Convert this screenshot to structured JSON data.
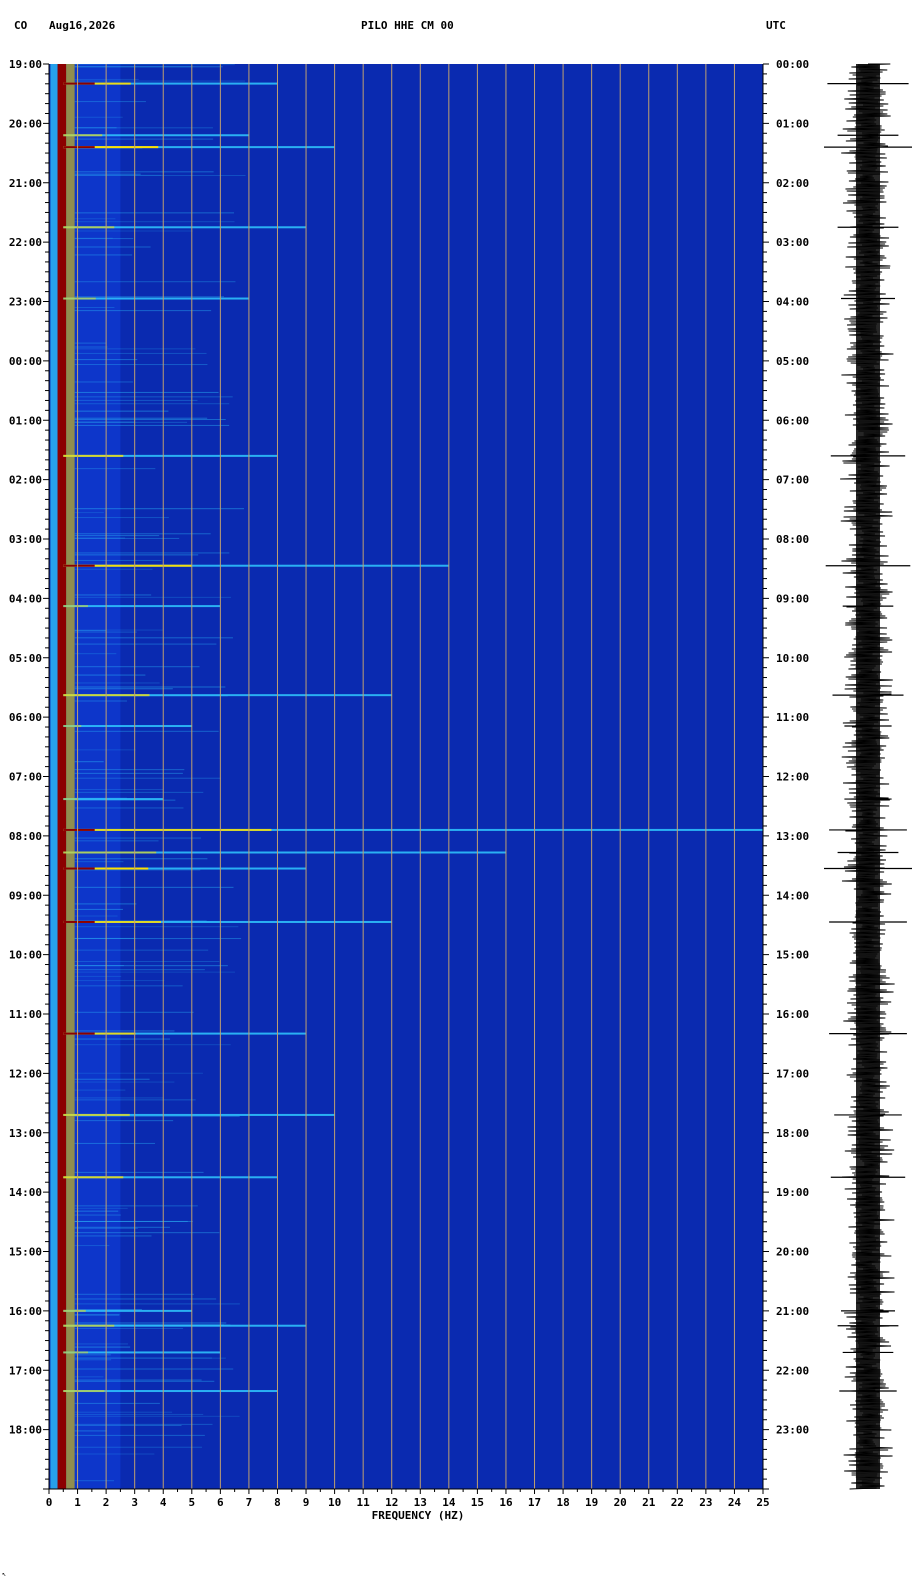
{
  "header": {
    "network": "CO",
    "date": "Aug16,2026",
    "channel": "PILO HHE CM 00",
    "timezone": "UTC"
  },
  "chart_data": {
    "type": "heatmap",
    "title": "PILO HHE CM 00",
    "xlabel": "FREQUENCY (HZ)",
    "xlim": [
      0,
      25
    ],
    "x_ticks": [
      "0",
      "1",
      "2",
      "3",
      "4",
      "5",
      "6",
      "7",
      "8",
      "9",
      "10",
      "11",
      "12",
      "13",
      "14",
      "15",
      "16",
      "17",
      "18",
      "19",
      "20",
      "21",
      "22",
      "23",
      "24",
      "25"
    ],
    "left_time_labels": [
      "19:00",
      "20:00",
      "21:00",
      "22:00",
      "23:00",
      "00:00",
      "01:00",
      "02:00",
      "03:00",
      "04:00",
      "05:00",
      "06:00",
      "07:00",
      "08:00",
      "09:00",
      "10:00",
      "11:00",
      "12:00",
      "13:00",
      "14:00",
      "15:00",
      "16:00",
      "17:00",
      "18:00"
    ],
    "right_time_labels": [
      "00:00",
      "01:00",
      "02:00",
      "03:00",
      "04:00",
      "05:00",
      "06:00",
      "07:00",
      "08:00",
      "09:00",
      "10:00",
      "11:00",
      "12:00",
      "13:00",
      "14:00",
      "15:00",
      "16:00",
      "17:00",
      "18:00",
      "19:00",
      "20:00",
      "21:00",
      "22:00",
      "23:00"
    ],
    "hours_span": 24,
    "low_freq_band_hz": [
      0.3,
      0.6
    ],
    "events": [
      {
        "hour": 0.33,
        "max_hz": 8,
        "strength": 0.9
      },
      {
        "hour": 1.2,
        "max_hz": 7,
        "strength": 0.6
      },
      {
        "hour": 1.4,
        "max_hz": 10,
        "strength": 1.0
      },
      {
        "hour": 2.75,
        "max_hz": 9,
        "strength": 0.6
      },
      {
        "hour": 3.95,
        "max_hz": 7,
        "strength": 0.5
      },
      {
        "hour": 6.6,
        "max_hz": 8,
        "strength": 0.8
      },
      {
        "hour": 8.45,
        "max_hz": 14,
        "strength": 0.95
      },
      {
        "hour": 9.13,
        "max_hz": 6,
        "strength": 0.45
      },
      {
        "hour": 10.63,
        "max_hz": 12,
        "strength": 0.75
      },
      {
        "hour": 11.15,
        "max_hz": 5,
        "strength": 0.4
      },
      {
        "hour": 12.38,
        "max_hz": 4,
        "strength": 0.4
      },
      {
        "hour": 12.9,
        "max_hz": 25,
        "strength": 0.85
      },
      {
        "hour": 13.28,
        "max_hz": 16,
        "strength": 0.6
      },
      {
        "hour": 13.55,
        "max_hz": 9,
        "strength": 1.0
      },
      {
        "hour": 14.45,
        "max_hz": 12,
        "strength": 0.85
      },
      {
        "hour": 16.33,
        "max_hz": 9,
        "strength": 0.85
      },
      {
        "hour": 17.7,
        "max_hz": 10,
        "strength": 0.7
      },
      {
        "hour": 18.75,
        "max_hz": 8,
        "strength": 0.8
      },
      {
        "hour": 21.0,
        "max_hz": 5,
        "strength": 0.5
      },
      {
        "hour": 21.25,
        "max_hz": 9,
        "strength": 0.6
      },
      {
        "hour": 21.7,
        "max_hz": 6,
        "strength": 0.45
      },
      {
        "hour": 22.35,
        "max_hz": 8,
        "strength": 0.55
      }
    ],
    "grid": true,
    "colors": {
      "background": "#0a2ab0",
      "low": "#1040e0",
      "mid": "#30c8ff",
      "hot": "#ffe000",
      "max": "#8b0000",
      "gridline": "#c0a070",
      "trace": "#000000"
    }
  }
}
